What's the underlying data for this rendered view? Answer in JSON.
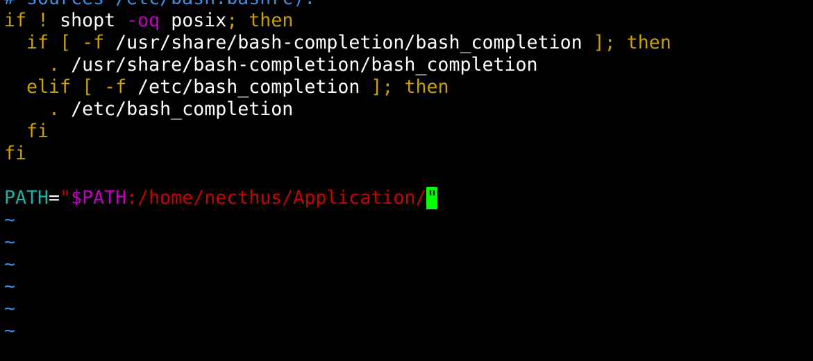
{
  "colors": {
    "background": "#000000",
    "text": "#ffffff",
    "comment": "#3a8fe6",
    "keyword": "#c8a000",
    "option": "#c200c2",
    "variable": "#20b2aa",
    "expansion": "#c200c2",
    "string": "#cc0000",
    "tilde": "#3a8fe6",
    "cursor": "#00ff00"
  },
  "lines": [
    {
      "tokens": [
        {
          "text": "# sources /etc/bash.bashrc).",
          "type": "comment"
        }
      ]
    },
    {
      "tokens": [
        {
          "text": "if",
          "type": "keyword"
        },
        {
          "text": " ",
          "type": "text"
        },
        {
          "text": "!",
          "type": "keyword"
        },
        {
          "text": " shopt ",
          "type": "text"
        },
        {
          "text": "-oq",
          "type": "option"
        },
        {
          "text": " posix",
          "type": "text"
        },
        {
          "text": ";",
          "type": "keyword"
        },
        {
          "text": " ",
          "type": "text"
        },
        {
          "text": "then",
          "type": "keyword"
        }
      ]
    },
    {
      "tokens": [
        {
          "text": "  ",
          "type": "text"
        },
        {
          "text": "if",
          "type": "keyword"
        },
        {
          "text": " ",
          "type": "text"
        },
        {
          "text": "[ -f",
          "type": "keyword"
        },
        {
          "text": " /usr/share/bash-completion/bash_completion ",
          "type": "text"
        },
        {
          "text": "];",
          "type": "keyword"
        },
        {
          "text": " ",
          "type": "text"
        },
        {
          "text": "then",
          "type": "keyword"
        }
      ]
    },
    {
      "tokens": [
        {
          "text": "    ",
          "type": "text"
        },
        {
          "text": ".",
          "type": "keyword"
        },
        {
          "text": " /usr/share/bash-completion/bash_completion",
          "type": "text"
        }
      ]
    },
    {
      "tokens": [
        {
          "text": "  ",
          "type": "text"
        },
        {
          "text": "elif",
          "type": "keyword"
        },
        {
          "text": " ",
          "type": "text"
        },
        {
          "text": "[ -f",
          "type": "keyword"
        },
        {
          "text": " /etc/bash_completion ",
          "type": "text"
        },
        {
          "text": "];",
          "type": "keyword"
        },
        {
          "text": " ",
          "type": "text"
        },
        {
          "text": "then",
          "type": "keyword"
        }
      ]
    },
    {
      "tokens": [
        {
          "text": "    ",
          "type": "text"
        },
        {
          "text": ".",
          "type": "keyword"
        },
        {
          "text": " /etc/bash_completion",
          "type": "text"
        }
      ]
    },
    {
      "tokens": [
        {
          "text": "  ",
          "type": "text"
        },
        {
          "text": "fi",
          "type": "keyword"
        }
      ]
    },
    {
      "tokens": [
        {
          "text": "fi",
          "type": "keyword"
        }
      ]
    },
    {
      "tokens": []
    },
    {
      "tokens": [
        {
          "text": "PATH",
          "type": "variable"
        },
        {
          "text": "=",
          "type": "text"
        },
        {
          "text": "\"",
          "type": "string"
        },
        {
          "text": "$PATH",
          "type": "expansion"
        },
        {
          "text": ":/home/necthus/Application/",
          "type": "string"
        },
        {
          "text": "\"",
          "type": "cursor"
        }
      ]
    },
    {
      "tokens": [
        {
          "text": "~",
          "type": "tilde"
        }
      ]
    },
    {
      "tokens": [
        {
          "text": "~",
          "type": "tilde"
        }
      ]
    },
    {
      "tokens": [
        {
          "text": "~",
          "type": "tilde"
        }
      ]
    },
    {
      "tokens": [
        {
          "text": "~",
          "type": "tilde"
        }
      ]
    },
    {
      "tokens": [
        {
          "text": "~",
          "type": "tilde"
        }
      ]
    },
    {
      "tokens": [
        {
          "text": "~",
          "type": "tilde"
        }
      ]
    }
  ]
}
